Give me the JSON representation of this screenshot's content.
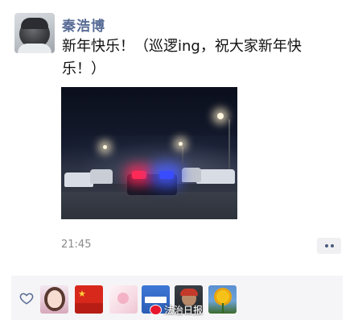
{
  "post": {
    "username": "秦浩博",
    "text": "新年快乐！（巡逻ing，祝大家新年快乐！）",
    "time": "21:45",
    "image_alt": "night-street-police-car"
  },
  "likes": {
    "icon": "heart-icon",
    "avatars": [
      "liker-1",
      "liker-2",
      "liker-3",
      "liker-4",
      "liker-5",
      "liker-6"
    ]
  },
  "watermark": {
    "text": "法治日报"
  },
  "colors": {
    "username": "#576b95",
    "likes_bg": "#f5f5f7",
    "more_dots": "#4a5a80"
  }
}
